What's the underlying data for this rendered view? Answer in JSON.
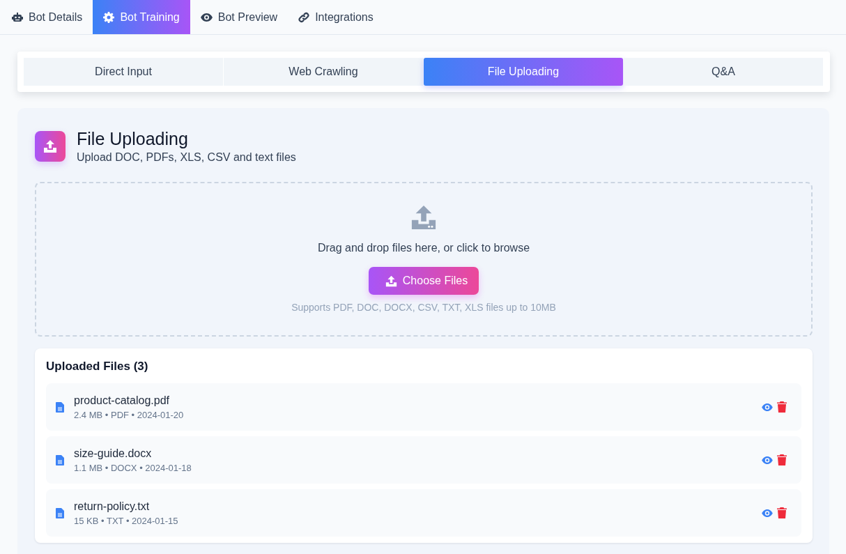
{
  "main_tabs": [
    {
      "label": "Bot Details",
      "selected": false
    },
    {
      "label": "Bot Training",
      "selected": true
    },
    {
      "label": "Bot Preview",
      "selected": false
    },
    {
      "label": "Integrations",
      "selected": false
    }
  ],
  "training_tabs": [
    {
      "label": "Direct Input",
      "selected": false
    },
    {
      "label": "Web Crawling",
      "selected": false
    },
    {
      "label": "File Uploading",
      "selected": true
    },
    {
      "label": "Q&A",
      "selected": false
    }
  ],
  "section": {
    "title": "File Uploading",
    "subtitle": "Upload DOC, PDFs, XLS, CSV and text files"
  },
  "dropzone": {
    "prompt": "Drag and drop files here, or click to browse",
    "button": "Choose Files",
    "hint": "Supports PDF, DOC, DOCX, CSV, TXT, XLS files up to 10MB"
  },
  "uploaded_files": {
    "title": "Uploaded Files (3)",
    "files": [
      {
        "name": "product-catalog.pdf",
        "meta": "2.4 MB • PDF • 2024-01-20"
      },
      {
        "name": "size-guide.docx",
        "meta": "1.1 MB • DOCX • 2024-01-18"
      },
      {
        "name": "return-policy.txt",
        "meta": "15 KB • TXT • 2024-01-15"
      }
    ]
  }
}
